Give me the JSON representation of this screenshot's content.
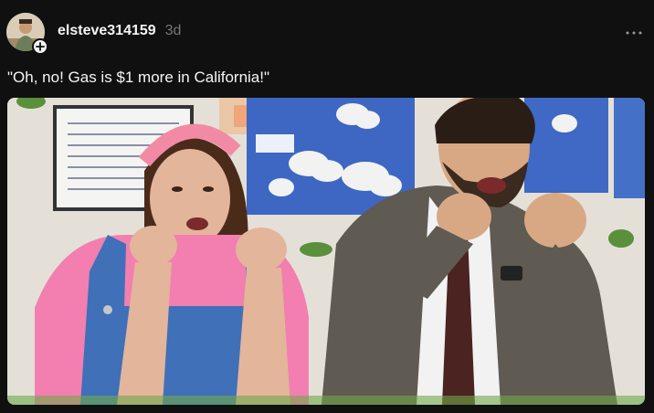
{
  "post": {
    "username": "elsteve314159",
    "timestamp": "3d",
    "caption": "\"Oh, no! Gas is $1 more in California!\"",
    "icons": {
      "follow": "plus-icon",
      "more": "ellipsis-icon"
    },
    "media": {
      "kind": "video-frame",
      "subject": "two presenters reacting in a classroom"
    }
  },
  "colors": {
    "background": "#101010",
    "text_primary": "#f3f5f7",
    "text_secondary": "#777777"
  }
}
